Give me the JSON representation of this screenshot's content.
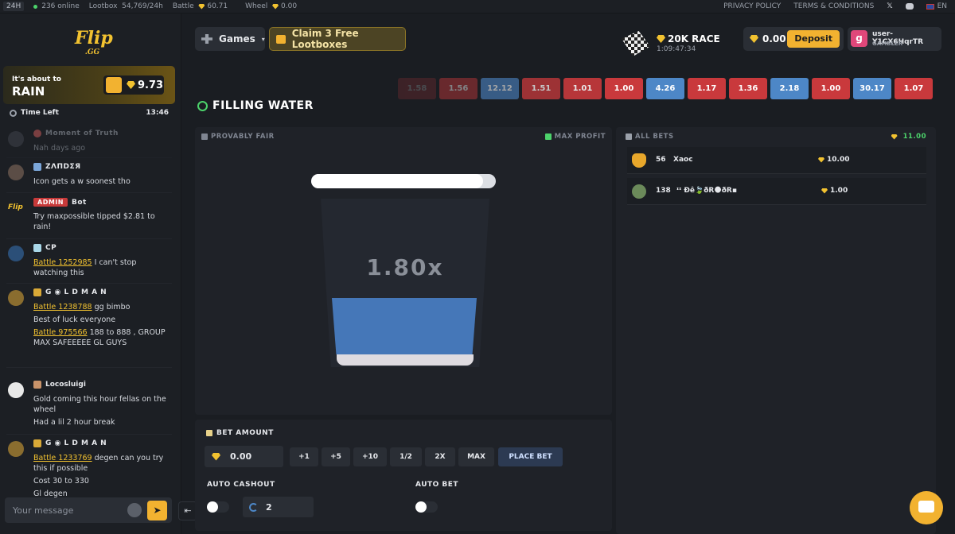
{
  "topbar": {
    "tag": "24H",
    "online": "236 online",
    "lootbox_label": "Lootbox",
    "lootbox_value": "54,769/24h",
    "battle_label": "Battle",
    "battle_value": "60.71",
    "wheel_label": "Wheel",
    "wheel_value": "0.00",
    "privacy": "PRIVACY POLICY",
    "terms": "TERMS & CONDITIONS",
    "lang": "EN"
  },
  "sidebar": {
    "logo_main": "Flip",
    "logo_sub": ".GG",
    "rain_line1": "It's about to",
    "rain_line2": "RAIN",
    "rain_amount": "9.73",
    "time_left_label": "Time Left",
    "time_left_value": "13:46",
    "messages": [
      {
        "name": "Moment of Truth",
        "text": "Nah days ago"
      },
      {
        "name": "ZΛПDΣЯ",
        "text": "Icon gets a w soonest tho"
      },
      {
        "badge": "ADMIN",
        "name": "Bot",
        "text": "Try maxpossible tipped $2.81 to rain!"
      },
      {
        "name": "CP",
        "link": "Battle 1252985",
        "text": " I can't stop watching this"
      },
      {
        "name": "G ◉ L D M A N",
        "link": "Battle 1238788",
        "text": " gg bimbo",
        "text2": "Best of luck everyone",
        "link3": "Battle 975566",
        "text3": " 188 to 888 , GROUP MAX SAFEEEEE GL GUYS"
      },
      {
        "name": "Locosluigi",
        "text": "Gold coming this hour fellas on the wheel",
        "text2": "Had a lil 2 hour break"
      },
      {
        "name": "G ◉ L D M A N",
        "link": "Battle 1233769",
        "text": " degen can you try this if possible",
        "text2": "Cost 30 to 330",
        "text3": "Gl degen"
      }
    ],
    "input_placeholder": "Your message"
  },
  "header": {
    "games": "Games",
    "claim": "Claim 3 Free Lootboxes",
    "race_title": "20K RACE",
    "race_timer": "1:09:47:34",
    "balance": "0.00",
    "deposit": "Deposit",
    "user_initial": "g",
    "username": "user-Y1CX6HqrTR",
    "user_role": "GAMBLER"
  },
  "history": [
    {
      "v": "1.58",
      "c": "r"
    },
    {
      "v": "1.56",
      "c": "r"
    },
    {
      "v": "12.12",
      "c": "b"
    },
    {
      "v": "1.51",
      "c": "r"
    },
    {
      "v": "1.01",
      "c": "r"
    },
    {
      "v": "1.00",
      "c": "r"
    },
    {
      "v": "4.26",
      "c": "b"
    },
    {
      "v": "1.17",
      "c": "r"
    },
    {
      "v": "1.36",
      "c": "r"
    },
    {
      "v": "2.18",
      "c": "b"
    },
    {
      "v": "1.00",
      "c": "r"
    },
    {
      "v": "30.17",
      "c": "b"
    },
    {
      "v": "1.07",
      "c": "r"
    }
  ],
  "game": {
    "title": "FILLING WATER",
    "provably_fair": "PROVABLY FAIR",
    "max_profit": "MAX PROFIT",
    "multiplier": "1.80x",
    "progress": 0.93,
    "water_level": 0.36
  },
  "bets": {
    "title": "ALL BETS",
    "total": "11.00",
    "rows": [
      {
        "level": "56",
        "name": "Xaoc",
        "amount": "10.00"
      },
      {
        "level": "138",
        "name": "ᶦᶦ Ðê🍃ðR🌑ðR▪",
        "amount": "1.00"
      }
    ]
  },
  "controls": {
    "bet_amount_label": "BET AMOUNT",
    "bet_value": "0.00",
    "btn_plus1": "+1",
    "btn_plus5": "+5",
    "btn_plus10": "+10",
    "btn_half": "1/2",
    "btn_double": "2X",
    "btn_max": "MAX",
    "place_bet": "PLACE BET",
    "auto_cashout_label": "AUTO CASHOUT",
    "auto_cashout_value": "2",
    "auto_bet_label": "AUTO BET"
  },
  "colors": {
    "accent": "#f2b230",
    "red": "#c9393c",
    "blue": "#4d87c7",
    "water": "#4577b8"
  }
}
